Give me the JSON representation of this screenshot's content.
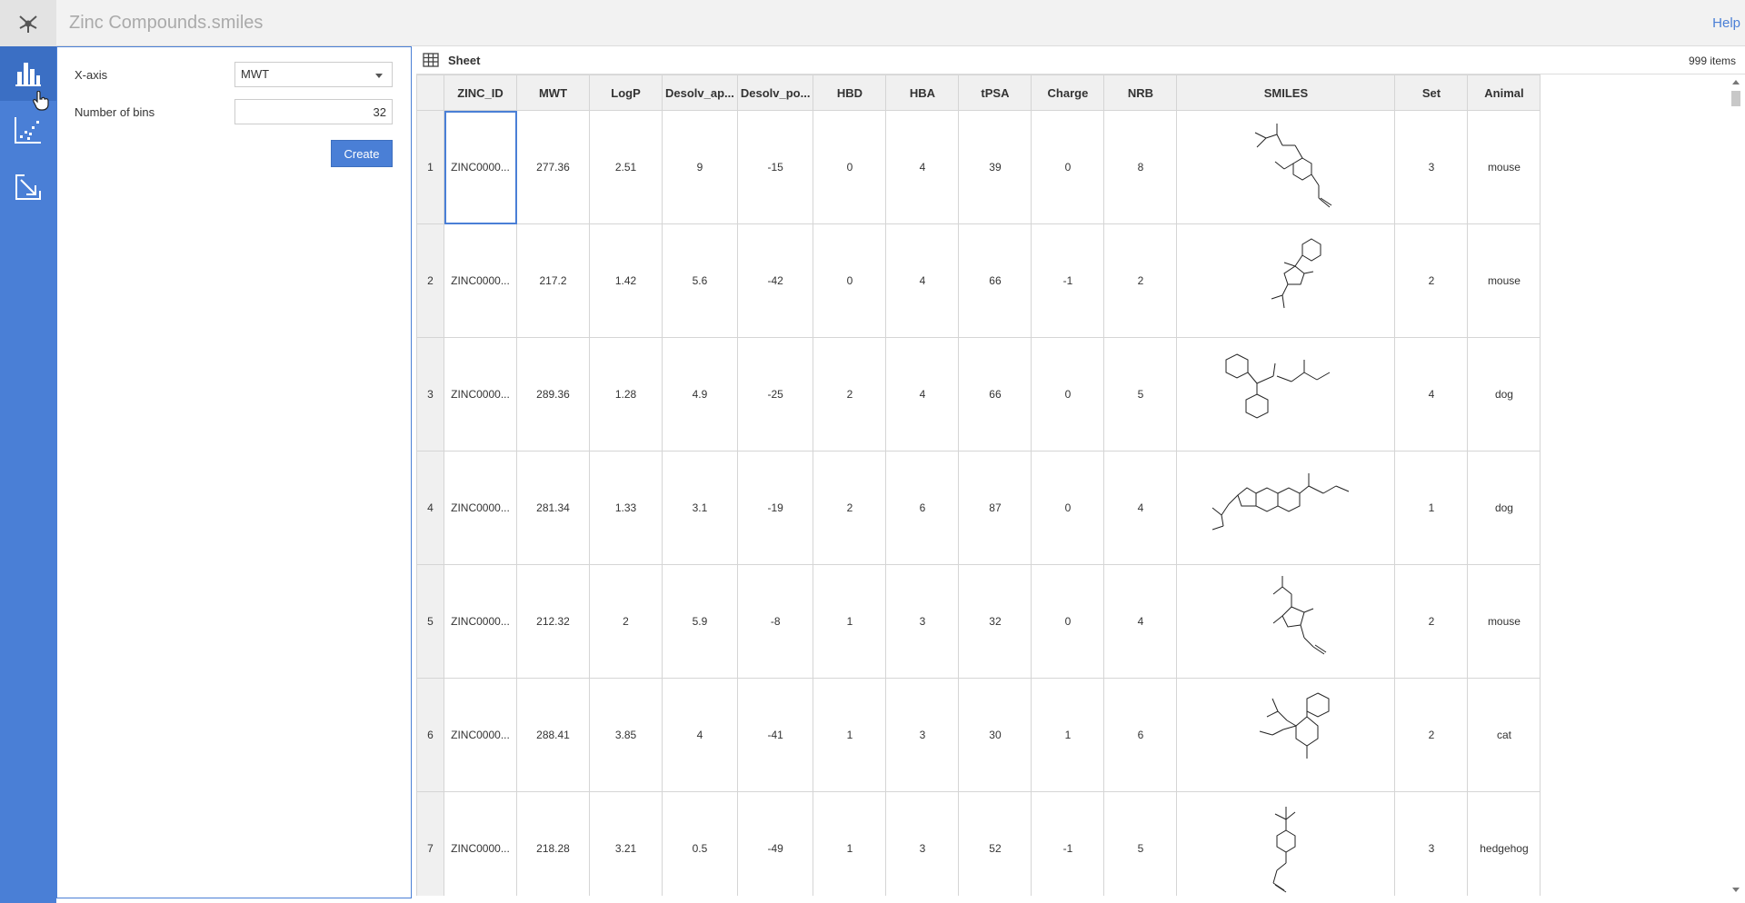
{
  "app": {
    "title": "Zinc Compounds.smiles",
    "help_label": "Help"
  },
  "rail": {
    "items": [
      "histogram-icon",
      "scatter-plot-icon",
      "export-icon"
    ],
    "active": "histogram-icon"
  },
  "settings": {
    "xaxis_label": "X-axis",
    "xaxis_value": "MWT",
    "bins_label": "Number of bins",
    "bins_value": "32",
    "create_label": "Create"
  },
  "sheet": {
    "title": "Sheet",
    "item_count": "999 items",
    "columns": [
      "ZINC_ID",
      "MWT",
      "LogP",
      "Desolv_ap...",
      "Desolv_po...",
      "HBD",
      "HBA",
      "tPSA",
      "Charge",
      "NRB",
      "SMILES",
      "Set",
      "Animal"
    ],
    "rows": [
      {
        "num": "1",
        "zinc_id": "ZINC0000...",
        "mwt": "277.36",
        "logp": "2.51",
        "desolv_ap": "9",
        "desolv_po": "-15",
        "hbd": "0",
        "hba": "4",
        "tpsa": "39",
        "charge": "0",
        "nrb": "8",
        "set": "3",
        "animal": "mouse"
      },
      {
        "num": "2",
        "zinc_id": "ZINC0000...",
        "mwt": "217.2",
        "logp": "1.42",
        "desolv_ap": "5.6",
        "desolv_po": "-42",
        "hbd": "0",
        "hba": "4",
        "tpsa": "66",
        "charge": "-1",
        "nrb": "2",
        "set": "2",
        "animal": "mouse"
      },
      {
        "num": "3",
        "zinc_id": "ZINC0000...",
        "mwt": "289.36",
        "logp": "1.28",
        "desolv_ap": "4.9",
        "desolv_po": "-25",
        "hbd": "2",
        "hba": "4",
        "tpsa": "66",
        "charge": "0",
        "nrb": "5",
        "set": "4",
        "animal": "dog"
      },
      {
        "num": "4",
        "zinc_id": "ZINC0000...",
        "mwt": "281.34",
        "logp": "1.33",
        "desolv_ap": "3.1",
        "desolv_po": "-19",
        "hbd": "2",
        "hba": "6",
        "tpsa": "87",
        "charge": "0",
        "nrb": "4",
        "set": "1",
        "animal": "dog"
      },
      {
        "num": "5",
        "zinc_id": "ZINC0000...",
        "mwt": "212.32",
        "logp": "2",
        "desolv_ap": "5.9",
        "desolv_po": "-8",
        "hbd": "1",
        "hba": "3",
        "tpsa": "32",
        "charge": "0",
        "nrb": "4",
        "set": "2",
        "animal": "mouse"
      },
      {
        "num": "6",
        "zinc_id": "ZINC0000...",
        "mwt": "288.41",
        "logp": "3.85",
        "desolv_ap": "4",
        "desolv_po": "-41",
        "hbd": "1",
        "hba": "3",
        "tpsa": "30",
        "charge": "1",
        "nrb": "6",
        "set": "2",
        "animal": "cat"
      },
      {
        "num": "7",
        "zinc_id": "ZINC0000...",
        "mwt": "218.28",
        "logp": "3.21",
        "desolv_ap": "0.5",
        "desolv_po": "-49",
        "hbd": "1",
        "hba": "3",
        "tpsa": "52",
        "charge": "-1",
        "nrb": "5",
        "set": "3",
        "animal": "hedgehog"
      }
    ]
  },
  "colors": {
    "accent": "#4a7fd6",
    "rail_active": "#3b6fc4",
    "header_bg": "#f0f0f0"
  }
}
